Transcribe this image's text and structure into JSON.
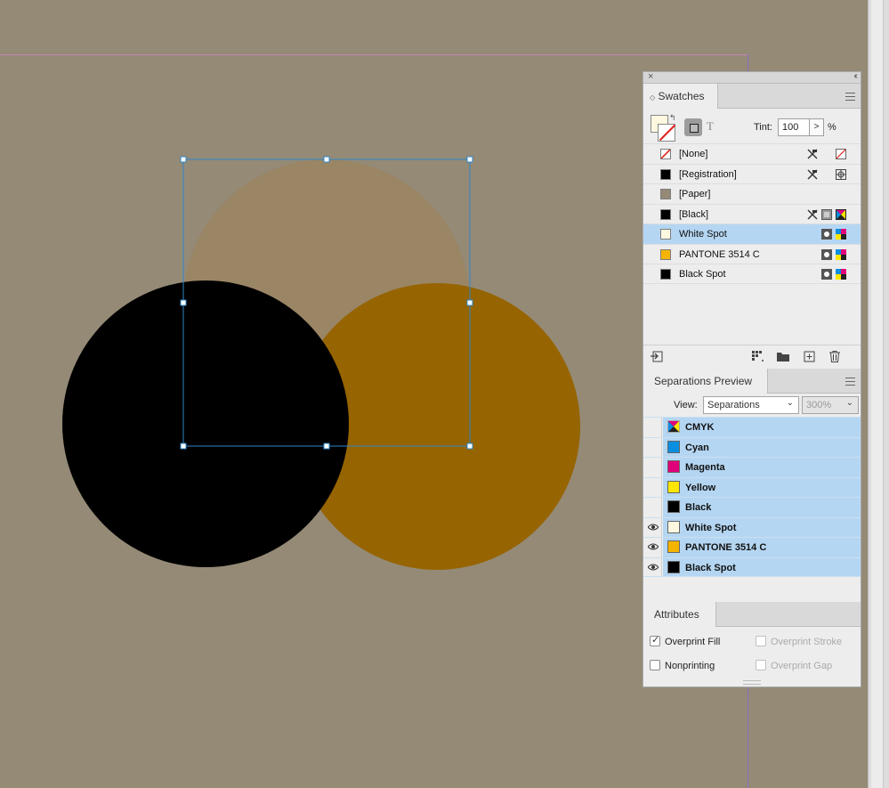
{
  "colors": {
    "canvas": "#948a76",
    "black_circle": "#000000",
    "orange_circle": "#966400",
    "tan_circle": "#9a8565",
    "selection": "#2f86c8",
    "panel_bg": "#ededed",
    "selected_row": "#b5d6f2"
  },
  "panel": {
    "close_icon": "×",
    "collapse_icon": "‹‹"
  },
  "swatches": {
    "tab_label": "Swatches",
    "tab_arrow": "◇",
    "fill_swatch": "#fff8e0",
    "text_mode_icon": "T",
    "tint_label": "Tint:",
    "tint_value": "100",
    "tint_arrow": ">",
    "tint_unit": "%",
    "items": [
      {
        "name": "[None]",
        "chip": "none",
        "icons": [
          "no-edit-icon",
          "none-swatch-icon"
        ]
      },
      {
        "name": "[Registration]",
        "chip": "#000000",
        "icons": [
          "no-edit-icon",
          "registration-icon"
        ]
      },
      {
        "name": "[Paper]",
        "chip": "#948a76",
        "icons": []
      },
      {
        "name": "[Black]",
        "chip": "#000000",
        "icons": [
          "no-edit-icon",
          "process-icon",
          "cmyk-icon"
        ]
      },
      {
        "name": "White Spot",
        "chip": "#fff8e0",
        "icons": [
          "spot-icon",
          "cmyk-icon"
        ],
        "selected": true
      },
      {
        "name": "PANTONE 3514 C",
        "chip": "#f5b400",
        "icons": [
          "spot-icon",
          "cmyk-icon"
        ]
      },
      {
        "name": "Black Spot",
        "chip": "#000000",
        "icons": [
          "spot-icon",
          "cmyk-icon"
        ]
      }
    ]
  },
  "separations": {
    "tab_label": "Separations Preview",
    "view_label": "View:",
    "view_value": "Separations",
    "zoom_value": "300%",
    "items": [
      {
        "name": "CMYK",
        "chip": "cmyk",
        "visible": false
      },
      {
        "name": "Cyan",
        "chip": "#0a8ee0",
        "visible": false
      },
      {
        "name": "Magenta",
        "chip": "#e0007a",
        "visible": false
      },
      {
        "name": "Yellow",
        "chip": "#ffe600",
        "visible": false
      },
      {
        "name": "Black",
        "chip": "#000000",
        "visible": false
      },
      {
        "name": "White Spot",
        "chip": "#fff8e0",
        "visible": true
      },
      {
        "name": "PANTONE 3514 C",
        "chip": "#f5b400",
        "visible": true
      },
      {
        "name": "Black Spot",
        "chip": "#000000",
        "visible": true
      }
    ]
  },
  "attributes": {
    "tab_label": "Attributes",
    "overprint_fill": {
      "label": "Overprint Fill",
      "checked": true
    },
    "overprint_stroke": {
      "label": "Overprint Stroke",
      "checked": false,
      "disabled": true
    },
    "nonprinting": {
      "label": "Nonprinting",
      "checked": false
    },
    "overprint_gap": {
      "label": "Overprint Gap",
      "checked": false,
      "disabled": true
    }
  }
}
